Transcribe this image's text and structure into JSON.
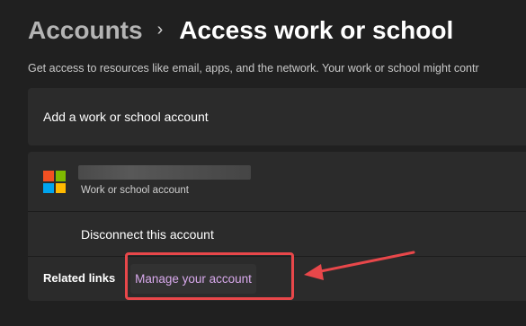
{
  "header": {
    "parent": "Accounts",
    "separator": "›",
    "title": "Access work or school"
  },
  "description": "Get access to resources like email, apps, and the network. Your work or school might contr",
  "add_account": {
    "label": "Add a work or school account"
  },
  "account": {
    "type_label": "Work or school account",
    "disconnect_label": "Disconnect this account"
  },
  "related": {
    "label": "Related links",
    "link": "Manage your account"
  },
  "colors": {
    "background": "#202020",
    "card": "#2b2b2b",
    "link": "#d8a9ec",
    "annotation": "#e8474a"
  }
}
